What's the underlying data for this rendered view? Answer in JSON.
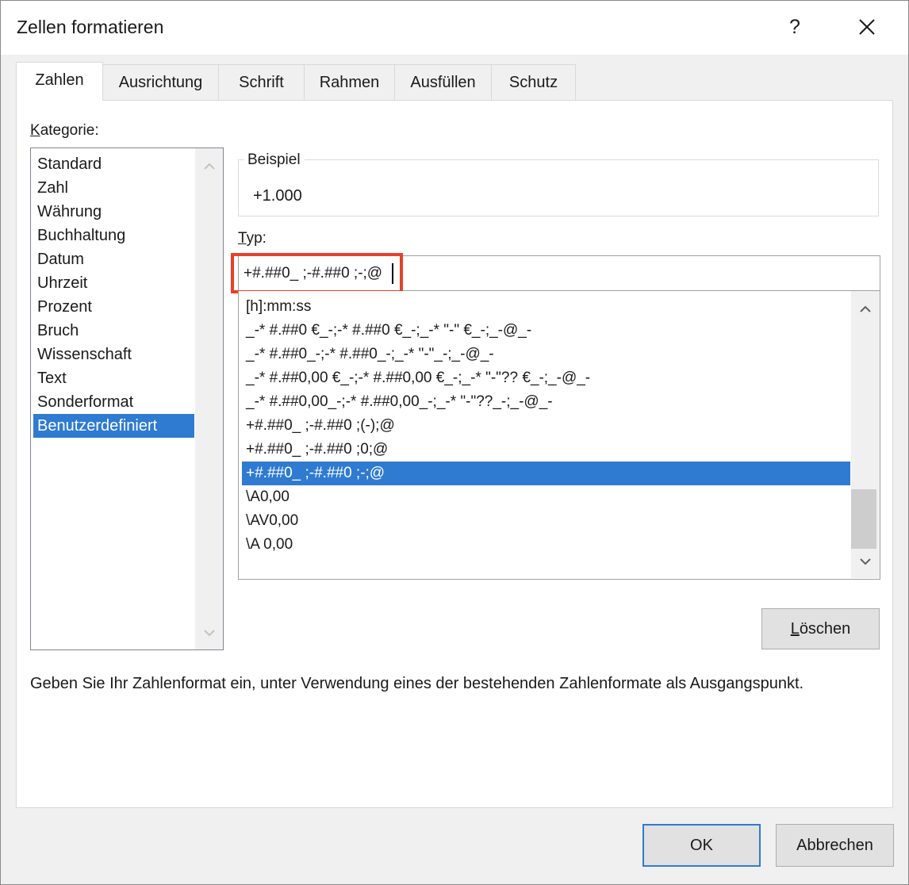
{
  "dialog": {
    "title": "Zellen formatieren",
    "help_label": "?",
    "close_icon": "close-icon"
  },
  "tabs": [
    {
      "label": "Zahlen",
      "active": true
    },
    {
      "label": "Ausrichtung",
      "active": false
    },
    {
      "label": "Schrift",
      "active": false
    },
    {
      "label": "Rahmen",
      "active": false
    },
    {
      "label": "Ausfüllen",
      "active": false
    },
    {
      "label": "Schutz",
      "active": false
    }
  ],
  "category": {
    "label_prefix": "",
    "label_accel": "K",
    "label_rest": "ategorie:",
    "items": [
      "Standard",
      "Zahl",
      "Währung",
      "Buchhaltung",
      "Datum",
      "Uhrzeit",
      "Prozent",
      "Bruch",
      "Wissenschaft",
      "Text",
      "Sonderformat",
      "Benutzerdefiniert"
    ],
    "selected": "Benutzerdefiniert"
  },
  "sample": {
    "legend": "Beispiel",
    "value": "+1.000"
  },
  "type": {
    "label_accel": "T",
    "label_rest": "yp:",
    "input_value": "+#.##0_ ;-#.##0 ;-;@",
    "formats": [
      "[h]:mm:ss",
      "_-* #.##0 €_-;-* #.##0 €_-;_-* \"-\" €_-;_-@_-",
      "_-* #.##0_-;-* #.##0_-;_-* \"-\"_-;_-@_-",
      "_-* #.##0,00 €_-;-* #.##0,00 €_-;_-* \"-\"?? €_-;_-@_-",
      "_-* #.##0,00_-;-* #.##0,00_-;_-* \"-\"??_-;_-@_-",
      "+#.##0_ ;-#.##0 ;(-);@",
      "+#.##0_ ;-#.##0 ;0;@",
      "+#.##0_ ;-#.##0 ;-;@",
      "\\A0,00",
      "\\AV0,00",
      "\\A 0,00"
    ],
    "selected": "+#.##0_ ;-#.##0 ;-;@"
  },
  "buttons": {
    "delete_accel": "L",
    "delete_rest": "öschen",
    "ok": "OK",
    "cancel": "Abbrechen"
  },
  "hint": "Geben Sie Ihr Zahlenformat ein, unter Verwendung eines der bestehenden Zahlenformate als Ausgangspunkt.",
  "colors": {
    "selection": "#2f7bd1",
    "highlight_border": "#e8402a"
  }
}
